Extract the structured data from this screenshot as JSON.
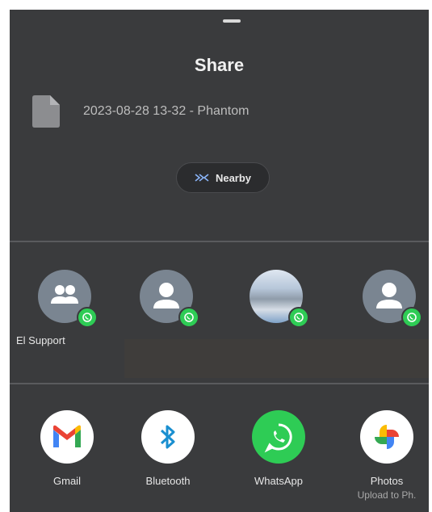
{
  "sheet": {
    "title": "Share",
    "file": {
      "name": "2023-08-28 13-32 - Phantom",
      "icon": "document-icon"
    },
    "nearby": {
      "label": "Nearby",
      "icon": "nearby-share-icon"
    }
  },
  "contacts": [
    {
      "label": "El Support",
      "avatar": "group-icon",
      "badge": "whatsapp-badge-icon"
    },
    {
      "label": "",
      "avatar": "person-icon",
      "badge": "whatsapp-badge-icon"
    },
    {
      "label": "",
      "avatar": "photo-avatar",
      "badge": "whatsapp-badge-icon"
    },
    {
      "label": "",
      "avatar": "person-icon",
      "badge": "whatsapp-badge-icon"
    }
  ],
  "apps": [
    {
      "label": "Gmail",
      "sub": "",
      "icon": "gmail-icon"
    },
    {
      "label": "Bluetooth",
      "sub": "",
      "icon": "bluetooth-icon"
    },
    {
      "label": "WhatsApp",
      "sub": "",
      "icon": "whatsapp-icon"
    },
    {
      "label": "Photos",
      "sub": "Upload to Ph.",
      "icon": "google-photos-icon"
    }
  ],
  "colors": {
    "sheet_bg": "#3a3b3d",
    "whatsapp_green": "#2ecc55",
    "avatar_gray": "#7a8591"
  }
}
